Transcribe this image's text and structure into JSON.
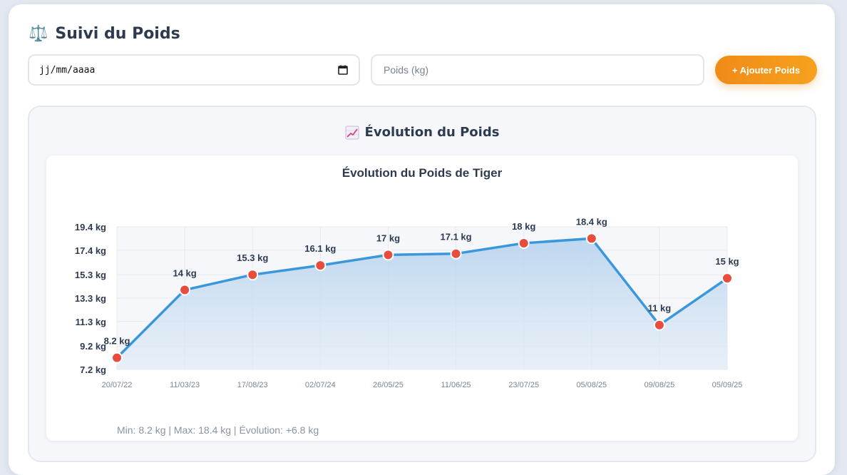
{
  "header": {
    "icon": "balance-scale-icon",
    "icon_glyph": "⚖️",
    "title": "Suivi du Poids"
  },
  "form": {
    "date_value": "jj/mm/aaaa",
    "weight_placeholder": "Poids (kg)",
    "add_button_label": "+ Ajouter Poids"
  },
  "section": {
    "icon": "chart-increasing-icon",
    "title": "Évolution du Poids"
  },
  "colors": {
    "line": "#3b97dc",
    "point": "#e74c3c",
    "accent": "#f39c12",
    "text": "#2d3b4f"
  },
  "chart_data": {
    "type": "line",
    "title": "Évolution du Poids de Tiger",
    "x": [
      "20/07/22",
      "11/03/23",
      "17/08/23",
      "02/07/24",
      "26/05/25",
      "11/06/25",
      "23/07/25",
      "05/08/25",
      "09/08/25",
      "05/09/25"
    ],
    "values": [
      8.2,
      14,
      15.3,
      16.1,
      17,
      17.1,
      18,
      18.4,
      11,
      15
    ],
    "data_labels": [
      "8.2 kg",
      "14 kg",
      "15.3 kg",
      "16.1 kg",
      "17 kg",
      "17.1 kg",
      "18 kg",
      "18.4 kg",
      "11 kg",
      "15 kg"
    ],
    "y_ticks": [
      7.2,
      9.2,
      11.3,
      13.3,
      15.3,
      17.4,
      19.4
    ],
    "y_tick_labels": [
      "7.2 kg",
      "9.2 kg",
      "11.3 kg",
      "13.3 kg",
      "15.3 kg",
      "17.4 kg",
      "19.4 kg"
    ],
    "ylim": [
      7.2,
      19.4
    ],
    "unit": "kg",
    "grid": true,
    "fill": "area"
  },
  "summary": "Min: 8.2 kg | Max: 18.4 kg | Évolution: +6.8 kg"
}
